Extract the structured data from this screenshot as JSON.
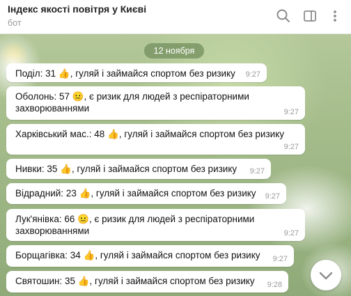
{
  "header": {
    "title": "Індекс якості повітря у Києві",
    "subtitle": "бот",
    "icons": [
      "search-icon",
      "sidebar-toggle-icon",
      "more-icon"
    ]
  },
  "date_label": "12 ноября",
  "messages": [
    {
      "text": "Поділ: 31 👍, гуляй і займайся спортом без ризику",
      "time": "9:27"
    },
    {
      "text": "Оболонь: 57 😐, є ризик для людей з респіраторними захворюваннями",
      "time": "9:27"
    },
    {
      "text": "Харківський мас.: 48 👍, гуляй і займайся спортом без ризику",
      "time": "9:27"
    },
    {
      "text": "Нивки: 35 👍, гуляй і займайся спортом без ризику",
      "time": "9:27"
    },
    {
      "text": "Відрадний: 23 👍, гуляй і займайся спортом без ризику",
      "time": "9:27"
    },
    {
      "text": "Лук'янівка: 66 😐, є ризик для людей з респіраторними захворюваннями",
      "time": "9:27"
    },
    {
      "text": "Борщагівка: 34 👍, гуляй і займайся спортом без ризику",
      "time": "9:27"
    },
    {
      "text": "Святошин: 35 👍, гуляй і займайся спортом без ризику",
      "time": "9:28"
    }
  ],
  "colors": {
    "accent": "#7a9664",
    "bubble": "#ffffff",
    "time": "#9a9a9a"
  }
}
